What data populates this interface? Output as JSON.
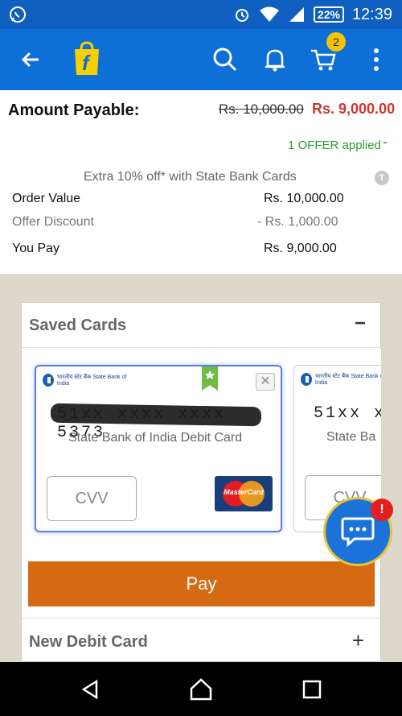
{
  "status_bar": {
    "time": "12:39",
    "battery": "22%"
  },
  "app_bar": {
    "cart_count": "2"
  },
  "amount": {
    "title": "Amount Payable:",
    "original_price": "Rs. 10,000.00",
    "final_price": "Rs. 9,000.00",
    "offer_applied": "1 OFFER applied",
    "offer_toggle": "-",
    "offer_note": "Extra 10% off* with State Bank Cards",
    "offer_info_icon": "T"
  },
  "breakdown": [
    {
      "label": "Order Value",
      "value": "Rs. 10,000.00"
    },
    {
      "label": "Offer Discount",
      "value": "- Rs. 1,000.00"
    },
    {
      "label": "You Pay",
      "value": "Rs. 9,000.00"
    }
  ],
  "saved_cards": {
    "title": "Saved Cards",
    "toggle": "−",
    "cards": [
      {
        "number": "51xx xxxx xxxx 5373",
        "bank": "State Bank of India Debit Card",
        "cvv_placeholder": "CVV",
        "brand": "MasterCard",
        "logo_text": "भारतीय स्टेट बैंक State Bank of India"
      },
      {
        "number": "51xx x",
        "bank": "State Ba",
        "cvv_placeholder": "CVV",
        "logo_text": "भारतीय स्टेट बैंक State Bank of India"
      }
    ]
  },
  "pay_button": "Pay",
  "new_debit_card": {
    "title": "New Debit Card",
    "toggle": "+"
  },
  "chat": {
    "badge": "!"
  },
  "colors": {
    "brand_blue": "#0e6fd6",
    "pay_orange": "#d56a12",
    "discount_red": "#d1342b",
    "offer_green": "#2b9a2b"
  }
}
